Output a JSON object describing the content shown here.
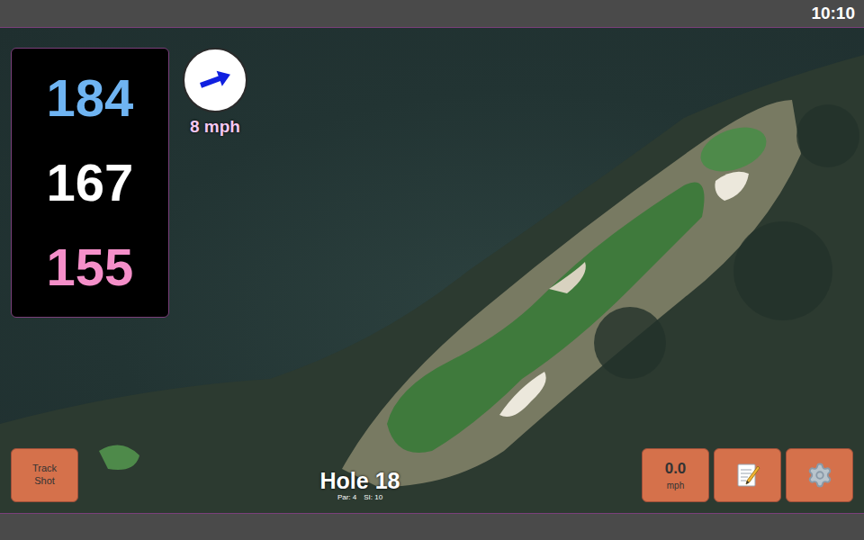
{
  "status_bar": {
    "time": "10:10"
  },
  "distances": [
    {
      "value": "184",
      "color": "#6fb4f2"
    },
    {
      "value": "167",
      "color": "#ffffff"
    },
    {
      "value": "155",
      "color": "#f58fc9"
    }
  ],
  "wind": {
    "speed": "8 mph",
    "heading": 70
  },
  "hole": {
    "title": "Hole 18",
    "par": "Par: 4",
    "si": "SI: 10"
  },
  "track_button": {
    "label": "Track Shot"
  },
  "speed_button": {
    "value": "0.0",
    "unit": "mph"
  },
  "tool_buttons": [
    {
      "kind": "notes"
    },
    {
      "kind": "settings"
    }
  ]
}
